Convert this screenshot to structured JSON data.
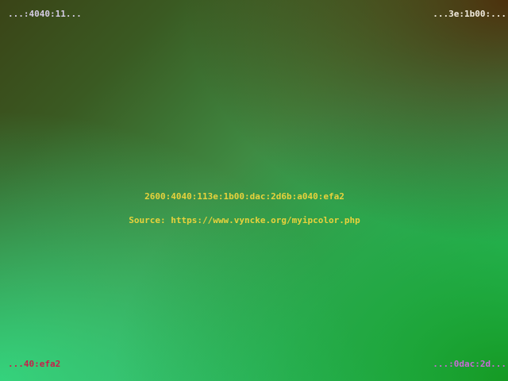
{
  "corners": {
    "top_left": "...:4040:11...",
    "top_right": "...3e:1b00:...",
    "bottom_left": "...40:efa2",
    "bottom_right": "...:0dac:2d..."
  },
  "center": {
    "address": "2600:4040:113e:1b00:dac:2d6b:a040:efa2",
    "source": "Source: https://www.vyncke.org/myipcolor.php"
  },
  "colors": {
    "top_left_text": "#d6cde6",
    "top_right_text": "#f2ece0",
    "bottom_left_text": "#c81e4a",
    "bottom_right_text": "#c86bd6",
    "center_text": "#e8d23c"
  }
}
